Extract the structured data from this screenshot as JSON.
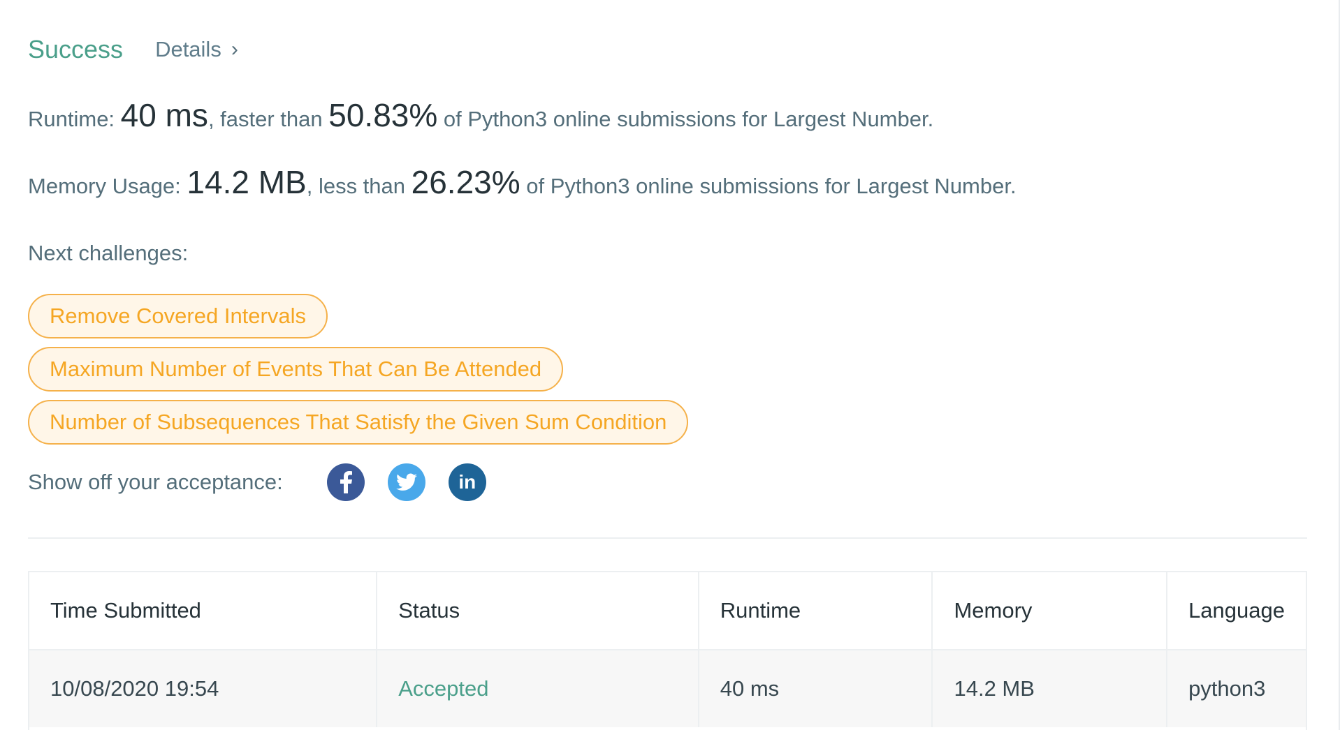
{
  "result": {
    "status": "Success",
    "details_label": "Details"
  },
  "runtime": {
    "label": "Runtime: ",
    "value": "40 ms",
    "mid": ", faster than ",
    "percent": "50.83%",
    "suffix": " of Python3 online submissions for Largest Number."
  },
  "memory": {
    "label": "Memory Usage: ",
    "value": "14.2 MB",
    "mid": ", less than ",
    "percent": "26.23%",
    "suffix": " of Python3 online submissions for Largest Number."
  },
  "next_challenges": {
    "label": "Next challenges:",
    "items": [
      "Remove Covered Intervals",
      "Maximum Number of Events That Can Be Attended",
      "Number of Subsequences That Satisfy the Given Sum Condition"
    ]
  },
  "share": {
    "label": "Show off your acceptance:",
    "icons": [
      "facebook-icon",
      "twitter-icon",
      "linkedin-icon"
    ]
  },
  "submissions": {
    "headers": [
      "Time Submitted",
      "Status",
      "Runtime",
      "Memory",
      "Language"
    ],
    "rows": [
      [
        "10/08/2020 19:54",
        "Accepted",
        "40 ms",
        "14.2 MB",
        "python3"
      ]
    ]
  },
  "colors": {
    "success": "#4a9f8a",
    "challenge_border": "#f5b14a",
    "challenge_text": "#f5a623",
    "facebook": "#3b5998",
    "twitter": "#49a8ea",
    "linkedin": "#1e6497"
  }
}
